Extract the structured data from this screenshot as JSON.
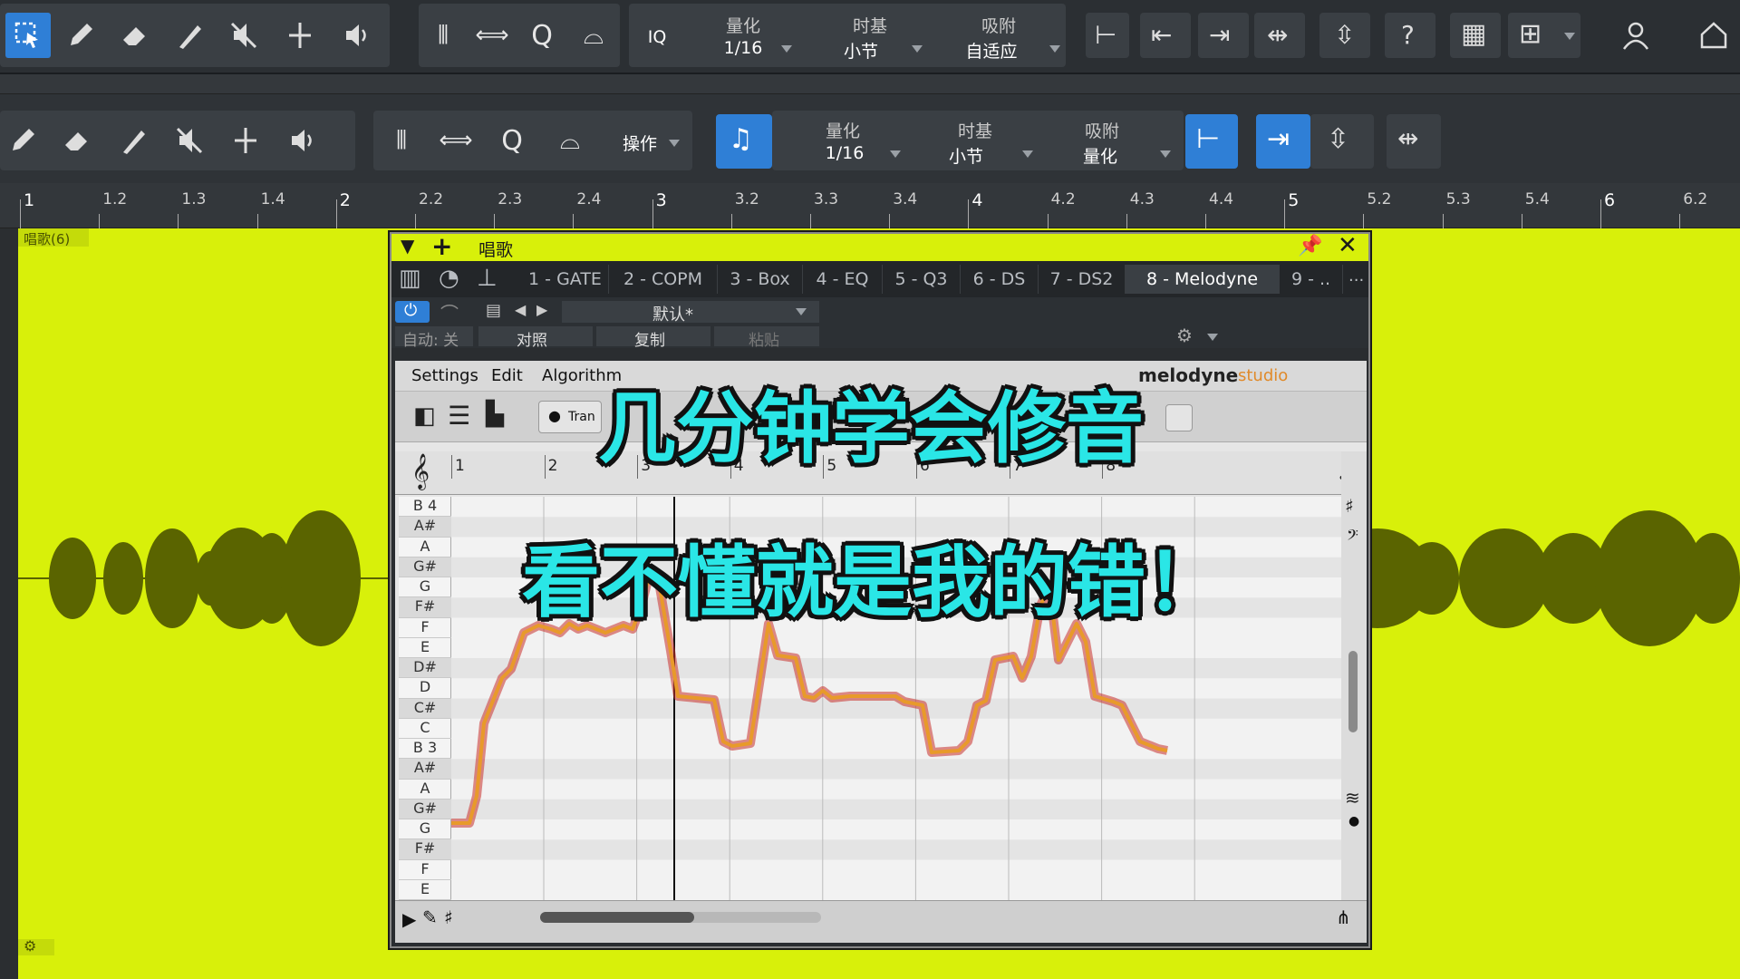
{
  "top_toolbar": {
    "quantize_label": "量化",
    "quantize_value": "1/16",
    "timebase_label": "时基",
    "timebase_value": "小节",
    "snap_label": "吸附",
    "snap_value": "自适应",
    "iq_label": "IQ",
    "help_label": "?"
  },
  "edit_toolbar": {
    "action_label": "操作",
    "quantize_label": "量化",
    "quantize_value": "1/16",
    "timebase_label": "时基",
    "timebase_value": "小节",
    "snap_label": "吸附",
    "snap_value": "量化"
  },
  "ruler": {
    "marks": [
      "1",
      "1.2",
      "1.3",
      "1.4",
      "2",
      "2.2",
      "2.3",
      "2.4",
      "3",
      "3.2",
      "3.3",
      "3.4",
      "4",
      "4.2",
      "4.3",
      "4.4",
      "5",
      "5.2",
      "5.3",
      "5.4",
      "6",
      "6.2"
    ]
  },
  "track": {
    "name": "唱歌(6)"
  },
  "plugin": {
    "title": "唱歌",
    "slots": [
      "1 - GATE",
      "2 - COPM",
      "3 - Box",
      "4 - EQ",
      "5 - Q3",
      "6 - DS",
      "7 - DS2",
      "8 - Melodyne",
      "9 - .."
    ],
    "more": "...",
    "preset": "默认*",
    "auto_label": "自动: 关",
    "compare_label": "对照",
    "copy_label": "复制",
    "paste_label": "粘贴"
  },
  "melodyne": {
    "menu": [
      "Settings",
      "Edit",
      "Algorithm"
    ],
    "brand": "melodyne",
    "brand_edition": "studio",
    "transport_label": "Tran",
    "bars": [
      "1",
      "2",
      "3",
      "4",
      "5",
      "6",
      "7",
      "8"
    ],
    "pitches": [
      "B 4",
      "A#",
      "A",
      "G#",
      "G",
      "F#",
      "F",
      "E",
      "D#",
      "D",
      "C#",
      "C",
      "B 3",
      "A#",
      "A",
      "G#",
      "G",
      "F#",
      "F",
      "E"
    ]
  },
  "overlay": {
    "line1": "几分钟学会修音",
    "line2": "看不懂就是我的错！"
  },
  "colors": {
    "accent_blue": "#2f7fd6",
    "track_yellow": "#d8f00a",
    "caption_cyan": "#2ae6e6",
    "pitch_curve": "#e89a2a"
  }
}
